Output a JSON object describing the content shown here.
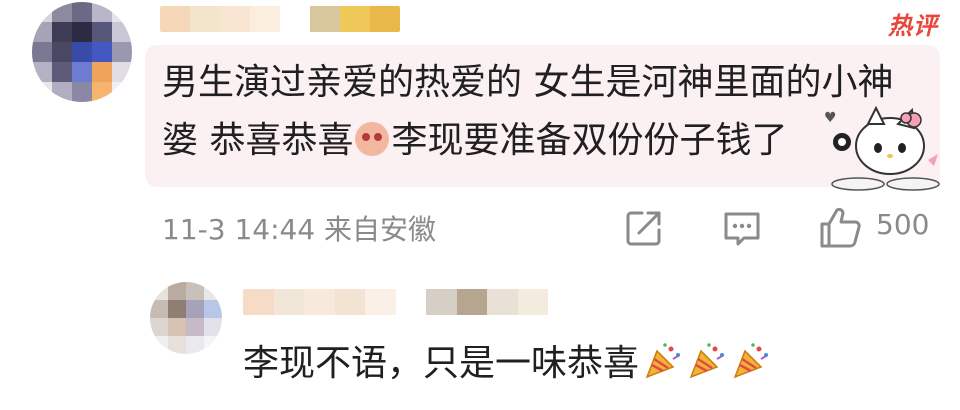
{
  "comment": {
    "hot_badge": "热评",
    "text_before_emoji": "男生演过亲爱的热爱的 女生是河神里面的小神婆 恭喜恭喜",
    "emoji": "embarrassed-emoji",
    "text_after_emoji": "李现要准备双份份子钱了",
    "timestamp": "11-3 14:44",
    "location": "来自安徽",
    "like_count": "500",
    "sticker": "hello-kitty-sticker"
  },
  "reply": {
    "text": "李现不语，只是一味恭喜",
    "emojis": [
      "party-popper-emoji",
      "party-popper-emoji",
      "party-popper-emoji"
    ]
  },
  "colors": {
    "bubble_bg": "#fbf0f2",
    "hot_badge": "#e8473c",
    "meta_text": "#8a8a8a"
  }
}
